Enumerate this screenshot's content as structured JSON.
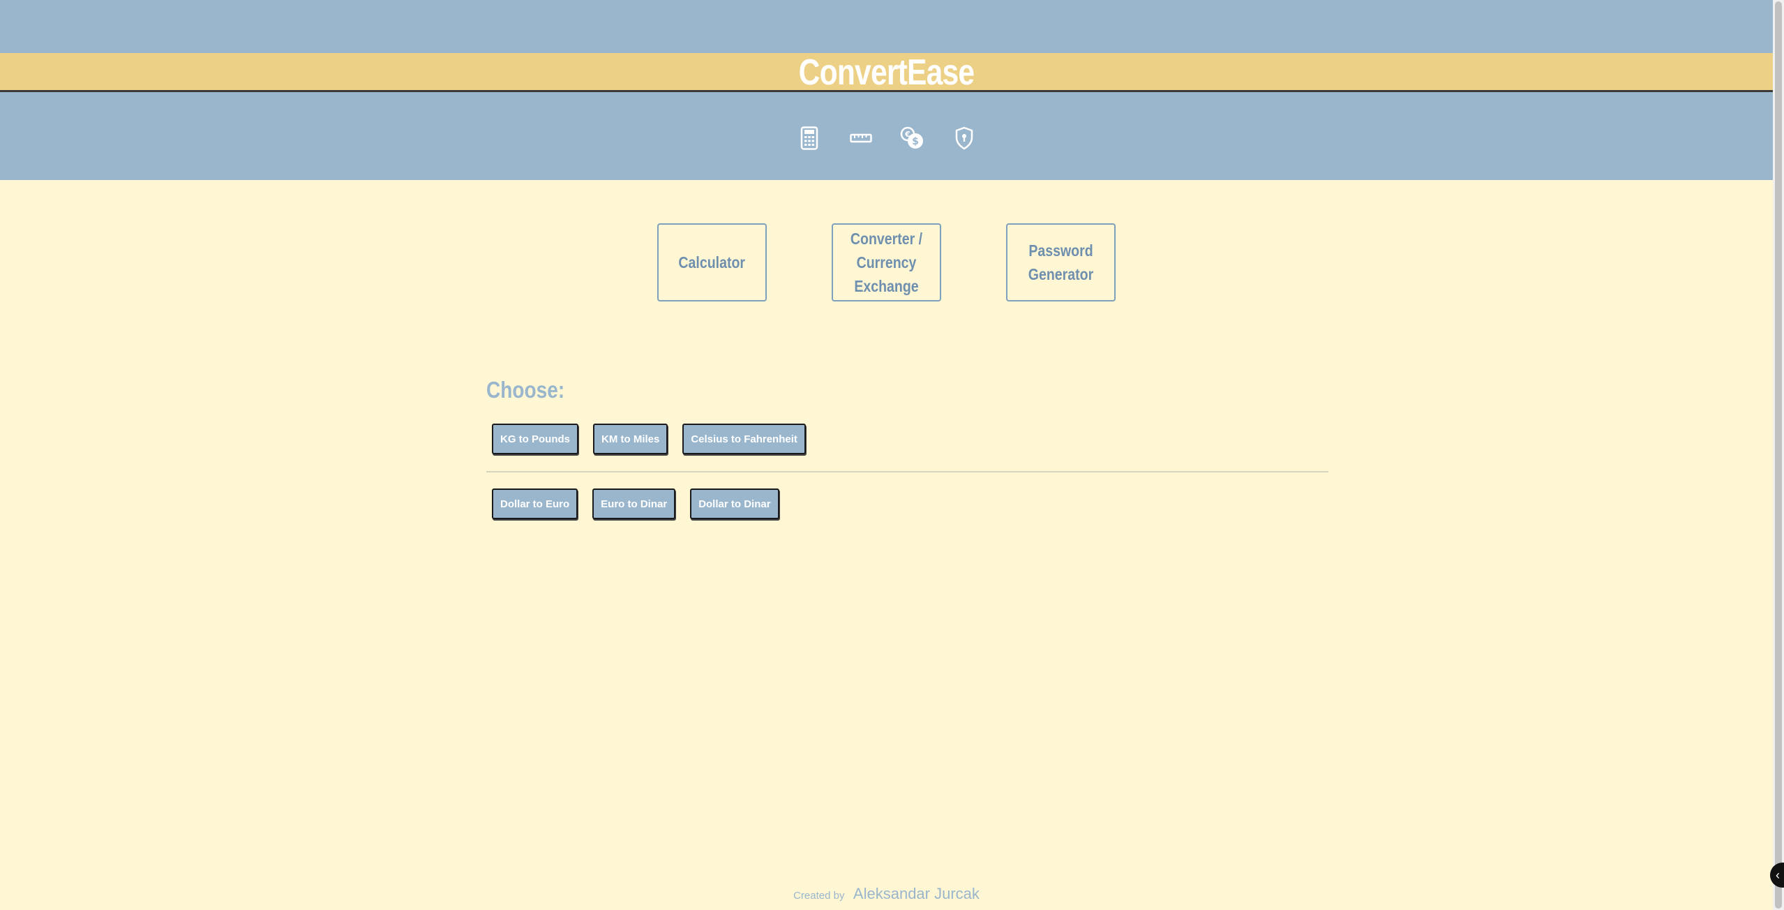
{
  "app": {
    "title": "ConvertEase"
  },
  "nav": {
    "icons": [
      {
        "name": "calculator-icon"
      },
      {
        "name": "ruler-icon"
      },
      {
        "name": "currency-exchange-icon"
      },
      {
        "name": "shield-lock-icon"
      }
    ]
  },
  "cards": [
    {
      "label": "Calculator"
    },
    {
      "label": "Converter / Currency Exchange"
    },
    {
      "label": "Password Generator"
    }
  ],
  "section": {
    "choose_label": "Choose:"
  },
  "unit_buttons": [
    {
      "label": "KG to Pounds"
    },
    {
      "label": "KM to Miles"
    },
    {
      "label": "Celsius to Fahrenheit"
    }
  ],
  "currency_buttons": [
    {
      "label": "Dollar to Euro"
    },
    {
      "label": "Euro to Dinar"
    },
    {
      "label": "Dollar to Dinar"
    }
  ],
  "footer": {
    "created_by": "Created by",
    "author": "Aleksandar Jurcak"
  },
  "colors": {
    "background": "#fff6d4",
    "header_blue": "#9ab6cd",
    "title_bar": "#ecd086",
    "card_text": "#6f8fae"
  }
}
